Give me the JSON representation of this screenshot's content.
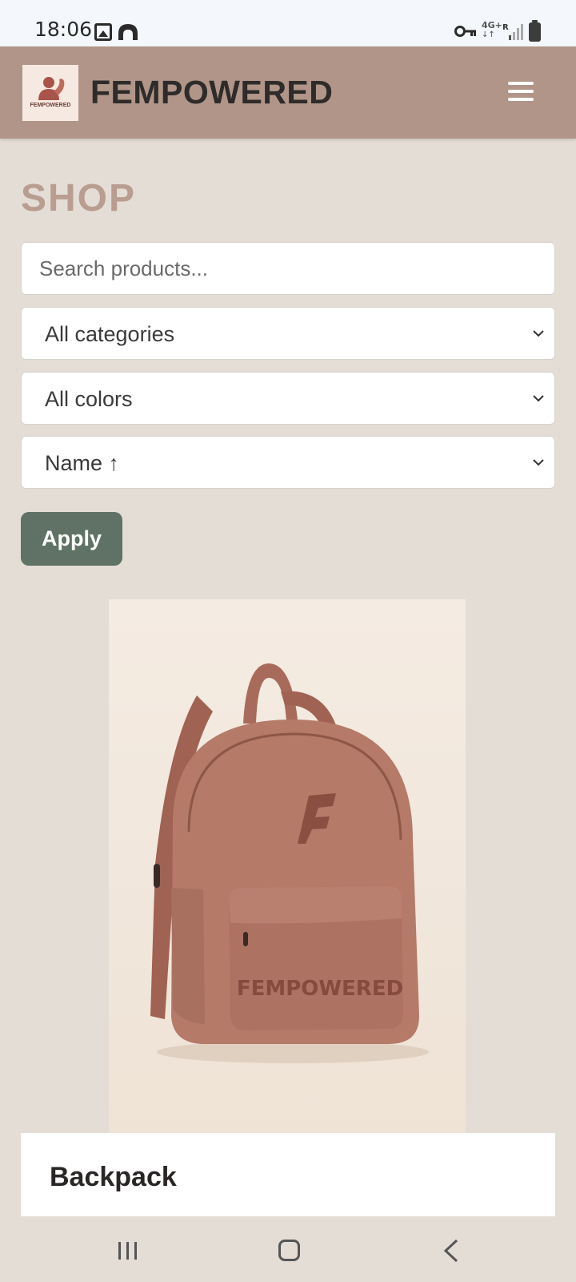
{
  "status_bar": {
    "time": "18:06",
    "network": "4G+",
    "roaming": "R",
    "icons": [
      "gallery-icon",
      "arch-icon",
      "vpn-key-icon",
      "signal-icon",
      "battery-icon"
    ]
  },
  "header": {
    "logo_text": "FEMPOWERED",
    "brand": "FEMPOWERED",
    "menu_icon": "hamburger-menu-icon"
  },
  "shop": {
    "title": "SHOP",
    "search": {
      "placeholder": "Search products...",
      "value": ""
    },
    "filters": {
      "category": "All categories",
      "color": "All colors",
      "sort": "Name ↑"
    },
    "apply_label": "Apply"
  },
  "products": [
    {
      "name": "Backpack",
      "image_text": "FEMPOWERED"
    }
  ],
  "nav_bar": {
    "icons": [
      "recent-apps-icon",
      "home-icon",
      "back-icon"
    ]
  },
  "colors": {
    "header_bg": "#b09588",
    "page_bg": "#e4ddd6",
    "title": "#b99d90",
    "apply_bg": "#5f7265",
    "product": "#b57a68"
  }
}
